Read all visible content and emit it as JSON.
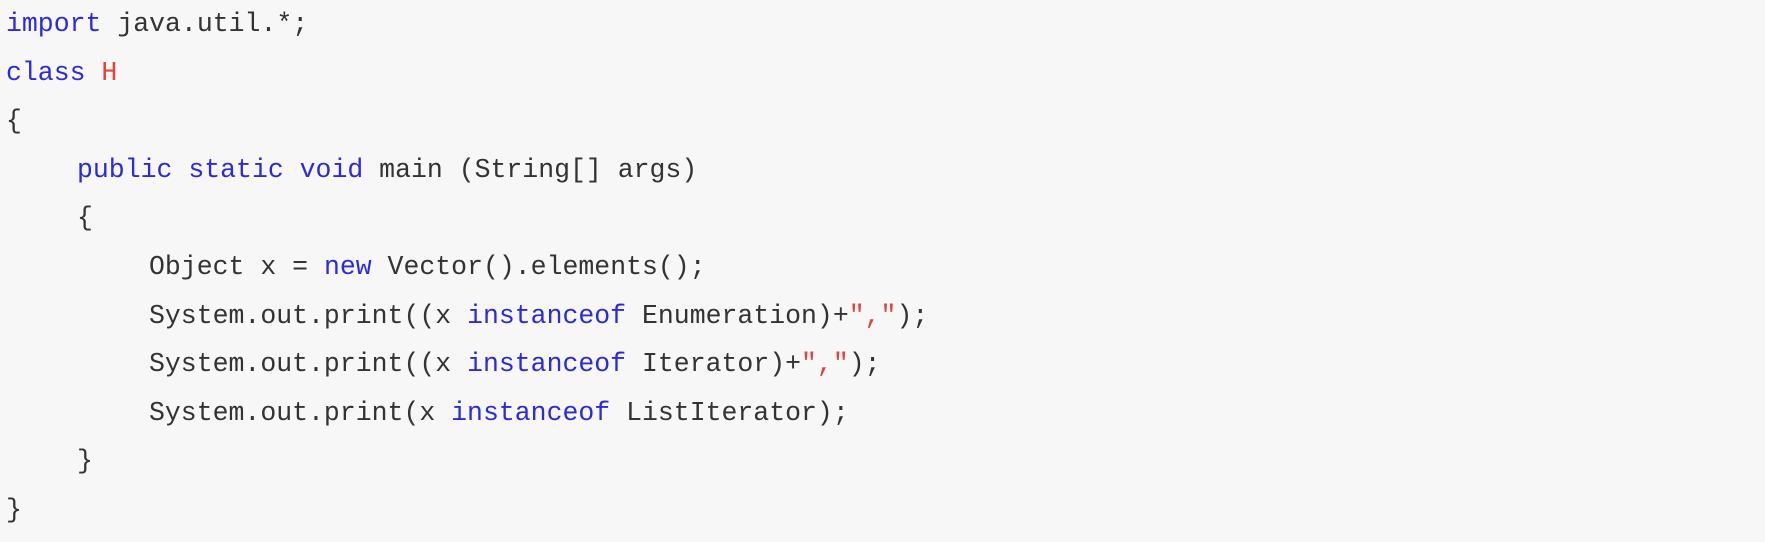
{
  "code": {
    "language": "java",
    "lines": [
      {
        "indent": 0,
        "tokens": [
          {
            "type": "keyword",
            "text": "import"
          },
          {
            "type": "plain",
            "text": " java.util.*;"
          }
        ]
      },
      {
        "indent": 0,
        "tokens": [
          {
            "type": "keyword",
            "text": "class"
          },
          {
            "type": "plain",
            "text": " "
          },
          {
            "type": "classname",
            "text": "H"
          }
        ]
      },
      {
        "indent": 0,
        "tokens": [
          {
            "type": "plain",
            "text": "{"
          }
        ]
      },
      {
        "indent": 1,
        "tokens": [
          {
            "type": "keyword",
            "text": "public"
          },
          {
            "type": "plain",
            "text": " "
          },
          {
            "type": "keyword",
            "text": "static"
          },
          {
            "type": "plain",
            "text": " "
          },
          {
            "type": "keyword",
            "text": "void"
          },
          {
            "type": "plain",
            "text": " main (String[] args)"
          }
        ]
      },
      {
        "indent": 1,
        "tokens": [
          {
            "type": "plain",
            "text": "{"
          }
        ]
      },
      {
        "indent": 2,
        "tokens": [
          {
            "type": "plain",
            "text": "Object x = "
          },
          {
            "type": "keyword",
            "text": "new"
          },
          {
            "type": "plain",
            "text": " Vector().elements();"
          }
        ]
      },
      {
        "indent": 2,
        "tokens": [
          {
            "type": "plain",
            "text": "System.out.print((x "
          },
          {
            "type": "keyword",
            "text": "instanceof"
          },
          {
            "type": "plain",
            "text": " Enumeration)+"
          },
          {
            "type": "string",
            "text": "\",\""
          },
          {
            "type": "plain",
            "text": ");"
          }
        ]
      },
      {
        "indent": 2,
        "tokens": [
          {
            "type": "plain",
            "text": "System.out.print((x "
          },
          {
            "type": "keyword",
            "text": "instanceof"
          },
          {
            "type": "plain",
            "text": " Iterator)+"
          },
          {
            "type": "string",
            "text": "\",\""
          },
          {
            "type": "plain",
            "text": ");"
          }
        ]
      },
      {
        "indent": 2,
        "tokens": [
          {
            "type": "plain",
            "text": "System.out.print(x "
          },
          {
            "type": "keyword",
            "text": "instanceof"
          },
          {
            "type": "plain",
            "text": " ListIterator);"
          }
        ]
      },
      {
        "indent": 1,
        "tokens": [
          {
            "type": "plain",
            "text": "}"
          }
        ]
      },
      {
        "indent": 0,
        "tokens": [
          {
            "type": "plain",
            "text": "}"
          }
        ]
      }
    ]
  },
  "colors": {
    "background": "#f7f7f7",
    "keyword": "#2a2ae0",
    "string": "#e8403a",
    "classname": "#e8403a",
    "plain": "#333333"
  }
}
